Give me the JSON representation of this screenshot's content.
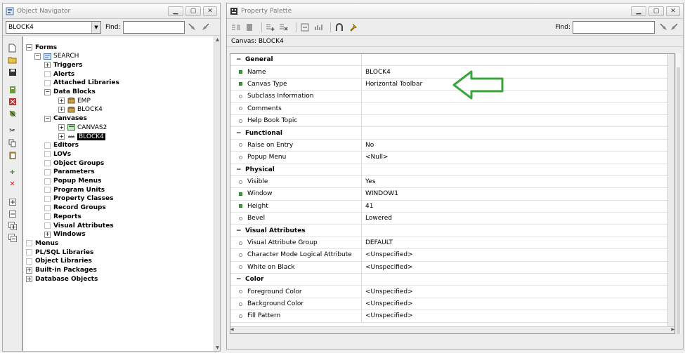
{
  "navigator": {
    "title": "Object Navigator",
    "selector_value": "BLOCK4",
    "find_label": "Find:",
    "find_value": "",
    "tree": [
      {
        "label": "Forms",
        "level": 0,
        "exp": "−",
        "bold": true
      },
      {
        "label": "SEARCH",
        "level": 1,
        "exp": "−",
        "bold": false,
        "icon": "form"
      },
      {
        "label": "Triggers",
        "level": 2,
        "exp": "+",
        "bold": true
      },
      {
        "label": "Alerts",
        "level": 2,
        "exp": "",
        "bold": true
      },
      {
        "label": "Attached Libraries",
        "level": 2,
        "exp": "",
        "bold": true
      },
      {
        "label": "Data Blocks",
        "level": 2,
        "exp": "−",
        "bold": true
      },
      {
        "label": "EMP",
        "level": 3,
        "exp": "+",
        "bold": false,
        "icon": "block"
      },
      {
        "label": "BLOCK4",
        "level": 3,
        "exp": "+",
        "bold": false,
        "icon": "block"
      },
      {
        "label": "Canvases",
        "level": 2,
        "exp": "−",
        "bold": true
      },
      {
        "label": "CANVAS2",
        "level": 3,
        "exp": "+",
        "bold": false,
        "icon": "canvas"
      },
      {
        "label": "BLOCK4",
        "level": 3,
        "exp": "+",
        "bold": false,
        "icon": "toolbar",
        "selected": true
      },
      {
        "label": "Editors",
        "level": 2,
        "exp": "",
        "bold": true
      },
      {
        "label": "LOVs",
        "level": 2,
        "exp": "",
        "bold": true
      },
      {
        "label": "Object Groups",
        "level": 2,
        "exp": "",
        "bold": true
      },
      {
        "label": "Parameters",
        "level": 2,
        "exp": "",
        "bold": true
      },
      {
        "label": "Popup Menus",
        "level": 2,
        "exp": "",
        "bold": true
      },
      {
        "label": "Program Units",
        "level": 2,
        "exp": "",
        "bold": true
      },
      {
        "label": "Property Classes",
        "level": 2,
        "exp": "",
        "bold": true
      },
      {
        "label": "Record Groups",
        "level": 2,
        "exp": "",
        "bold": true
      },
      {
        "label": "Reports",
        "level": 2,
        "exp": "",
        "bold": true
      },
      {
        "label": "Visual Attributes",
        "level": 2,
        "exp": "",
        "bold": true
      },
      {
        "label": "Windows",
        "level": 2,
        "exp": "+",
        "bold": true
      },
      {
        "label": "Menus",
        "level": 0,
        "exp": "",
        "bold": true
      },
      {
        "label": "PL/SQL Libraries",
        "level": 0,
        "exp": "",
        "bold": true
      },
      {
        "label": "Object Libraries",
        "level": 0,
        "exp": "",
        "bold": true
      },
      {
        "label": "Built-in Packages",
        "level": 0,
        "exp": "+",
        "bold": true
      },
      {
        "label": "Database Objects",
        "level": 0,
        "exp": "+",
        "bold": true
      }
    ]
  },
  "palette": {
    "title": "Property Palette",
    "find_label": "Find:",
    "find_value": "",
    "context": "Canvas: BLOCK4",
    "rows": [
      {
        "type": "cat",
        "name": "General",
        "value": ""
      },
      {
        "type": "prop",
        "mark": "sq",
        "name": "Name",
        "value": "BLOCK4"
      },
      {
        "type": "prop",
        "mark": "sq",
        "name": "Canvas Type",
        "value": "Horizontal Toolbar"
      },
      {
        "type": "prop",
        "mark": "dot",
        "name": "Subclass Information",
        "value": ""
      },
      {
        "type": "prop",
        "mark": "dot",
        "name": "Comments",
        "value": ""
      },
      {
        "type": "prop",
        "mark": "dot",
        "name": "Help Book Topic",
        "value": ""
      },
      {
        "type": "cat",
        "name": "Functional",
        "value": ""
      },
      {
        "type": "prop",
        "mark": "dot",
        "name": "Raise on Entry",
        "value": "No"
      },
      {
        "type": "prop",
        "mark": "dot",
        "name": "Popup Menu",
        "value": "<Null>"
      },
      {
        "type": "cat",
        "name": "Physical",
        "value": ""
      },
      {
        "type": "prop",
        "mark": "dot",
        "name": "Visible",
        "value": "Yes"
      },
      {
        "type": "prop",
        "mark": "sq",
        "name": "Window",
        "value": "WINDOW1"
      },
      {
        "type": "prop",
        "mark": "sq",
        "name": "Height",
        "value": "41"
      },
      {
        "type": "prop",
        "mark": "dot",
        "name": "Bevel",
        "value": "Lowered"
      },
      {
        "type": "cat",
        "name": "Visual Attributes",
        "value": ""
      },
      {
        "type": "prop",
        "mark": "dot",
        "name": "Visual Attribute Group",
        "value": "DEFAULT"
      },
      {
        "type": "prop",
        "mark": "dot",
        "name": "Character Mode Logical Attribute",
        "value": "<Unspecified>"
      },
      {
        "type": "prop",
        "mark": "dot",
        "name": "White on Black",
        "value": "<Unspecified>"
      },
      {
        "type": "cat",
        "name": "Color",
        "value": ""
      },
      {
        "type": "prop",
        "mark": "dot",
        "name": "Foreground Color",
        "value": "<Unspecified>"
      },
      {
        "type": "prop",
        "mark": "dot",
        "name": "Background Color",
        "value": "<Unspecified>"
      },
      {
        "type": "prop",
        "mark": "dot",
        "name": "Fill Pattern",
        "value": "<Unspecified>"
      }
    ]
  },
  "colors": {
    "annotation_arrow": "#3aa53a",
    "selection_bg": "#000000"
  }
}
